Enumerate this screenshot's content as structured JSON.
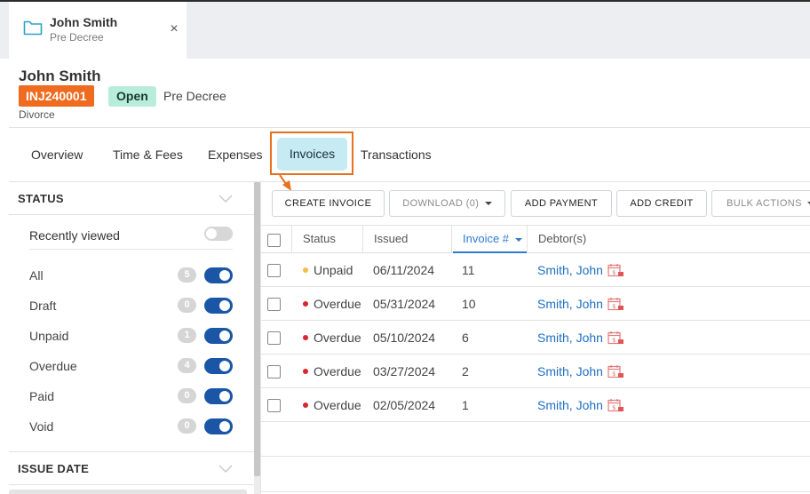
{
  "tab": {
    "title": "John Smith",
    "subtitle": "Pre Decree",
    "close_label": "×"
  },
  "header": {
    "client_name": "John Smith",
    "matter_id": "INJ240001",
    "status": "Open",
    "stage": "Pre Decree",
    "matter_type": "Divorce"
  },
  "nav": {
    "tabs": [
      {
        "label": "Overview"
      },
      {
        "label": "Time & Fees"
      },
      {
        "label": "Expenses"
      },
      {
        "label": "Invoices"
      },
      {
        "label": "Transactions"
      }
    ],
    "active": "Invoices"
  },
  "sidebar": {
    "status_title": "STATUS",
    "recently_viewed": "Recently viewed",
    "filters": [
      {
        "label": "All",
        "count": "5"
      },
      {
        "label": "Draft",
        "count": "0"
      },
      {
        "label": "Unpaid",
        "count": "1"
      },
      {
        "label": "Overdue",
        "count": "4"
      },
      {
        "label": "Paid",
        "count": "0"
      },
      {
        "label": "Void",
        "count": "0"
      }
    ],
    "issue_date_title": "ISSUE DATE"
  },
  "toolbar": {
    "create": "CREATE INVOICE",
    "download": "DOWNLOAD (0)",
    "add_payment": "ADD PAYMENT",
    "add_credit": "ADD CREDIT",
    "bulk_actions": "BULK ACTIONS"
  },
  "table": {
    "columns": {
      "status": "Status",
      "issued": "Issued",
      "invoice": "Invoice #",
      "debtors": "Debtor(s)"
    },
    "rows": [
      {
        "status": "Unpaid",
        "status_color": "#f0c04a",
        "issued": "06/11/2024",
        "invoice": "11",
        "debtor": "Smith, John"
      },
      {
        "status": "Overdue",
        "status_color": "#d9252b",
        "issued": "05/31/2024",
        "invoice": "10",
        "debtor": "Smith, John"
      },
      {
        "status": "Overdue",
        "status_color": "#d9252b",
        "issued": "05/10/2024",
        "invoice": "6",
        "debtor": "Smith, John"
      },
      {
        "status": "Overdue",
        "status_color": "#d9252b",
        "issued": "03/27/2024",
        "invoice": "2",
        "debtor": "Smith, John"
      },
      {
        "status": "Overdue",
        "status_color": "#d9252b",
        "issued": "02/05/2024",
        "invoice": "1",
        "debtor": "Smith, John"
      }
    ]
  },
  "colors": {
    "accent": "#ee6b1f",
    "primary": "#1a56a5",
    "link": "#1f6fc2",
    "active_tab_bg": "#c6ebf2"
  }
}
